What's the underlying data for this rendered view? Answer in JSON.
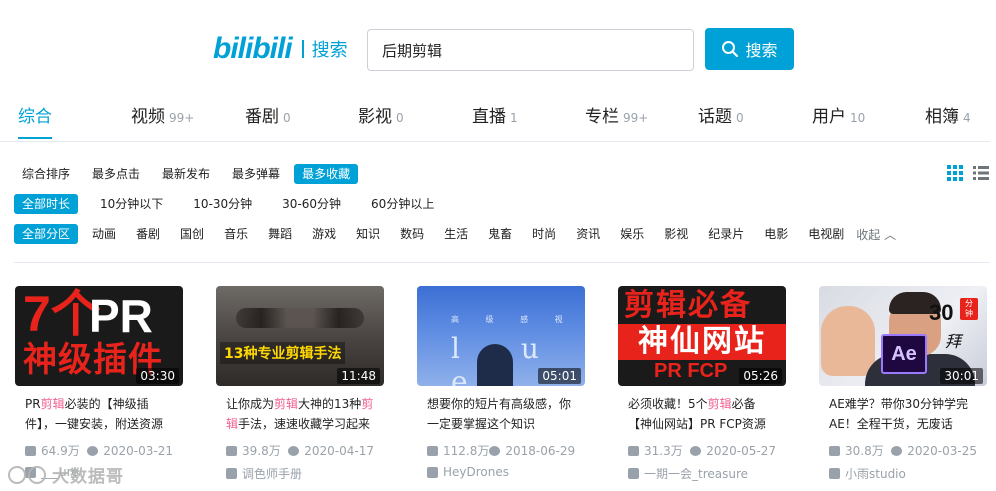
{
  "header": {
    "logo": "bilibili",
    "logo_text": "搜索",
    "search_value": "后期剪辑",
    "search_button": "搜索"
  },
  "tabs": [
    {
      "label": "综合",
      "count": ""
    },
    {
      "label": "视频",
      "count": "99+"
    },
    {
      "label": "番剧",
      "count": "0"
    },
    {
      "label": "影视",
      "count": "0"
    },
    {
      "label": "直播",
      "count": "1"
    },
    {
      "label": "专栏",
      "count": "99+"
    },
    {
      "label": "话题",
      "count": "0"
    },
    {
      "label": "用户",
      "count": "10"
    },
    {
      "label": "相簿",
      "count": "4"
    }
  ],
  "active_tab": "综合",
  "sort_options": [
    "综合排序",
    "最多点击",
    "最新发布",
    "最多弹幕",
    "最多收藏"
  ],
  "active_sort": "最多收藏",
  "duration_options": [
    "全部时长",
    "10分钟以下",
    "10-30分钟",
    "30-60分钟",
    "60分钟以上"
  ],
  "active_duration": "全部时长",
  "zone_options": [
    "全部分区",
    "动画",
    "番剧",
    "国创",
    "音乐",
    "舞蹈",
    "游戏",
    "知识",
    "数码",
    "生活",
    "鬼畜",
    "时尚",
    "资讯",
    "娱乐",
    "影视",
    "纪录片",
    "电影",
    "电视剧"
  ],
  "active_zone": "全部分区",
  "fold_label": "收起",
  "colors": {
    "accent": "#00a1d6",
    "highlight": "#f25d8e",
    "meta": "#99a2aa"
  },
  "videos": [
    {
      "duration": "03:30",
      "title_parts": [
        "PR",
        "剪辑",
        "必装的【神级插件】，一键安装，附送资源"
      ],
      "views": "64.9万",
      "date": "2020-03-21",
      "uploader": "___ure",
      "thumb_text": [
        "7个",
        "PR",
        "神级插件"
      ]
    },
    {
      "duration": "11:48",
      "title_parts": [
        "让你成为",
        "剪辑",
        "大神的13种",
        "剪辑",
        "手法，速速收藏学习起来"
      ],
      "views": "39.8万",
      "date": "2020-04-17",
      "uploader": "调色师手册",
      "thumb_text": [
        "13种专业剪辑手法"
      ]
    },
    {
      "duration": "05:01",
      "title_parts": [
        "想要你的短片有高级感，你一定要掌握这个知识"
      ],
      "views": "112.8万",
      "date": "2018-06-29",
      "uploader": "HeyDrones",
      "thumb_text": [
        "高 级 感 视 觉 分 享",
        "l  u  e"
      ]
    },
    {
      "duration": "05:26",
      "title_parts": [
        "必须收藏！5个",
        "剪辑",
        "必备【神仙网站】PR FCP资源"
      ],
      "views": "31.3万",
      "date": "2020-05-27",
      "uploader": "一期一会_treasure",
      "thumb_text": [
        "剪辑必备",
        "神仙网站",
        "PR FCP"
      ]
    },
    {
      "duration": "30:01",
      "title_parts": [
        "AE难学？带你30分钟学完AE！全程干货，无废话"
      ],
      "views": "30.8万",
      "date": "2020-03-25",
      "uploader": "小雨studio",
      "thumb_text": [
        "30",
        "分钟",
        "Ae",
        "拜"
      ]
    }
  ],
  "watermark": "大数据哥"
}
